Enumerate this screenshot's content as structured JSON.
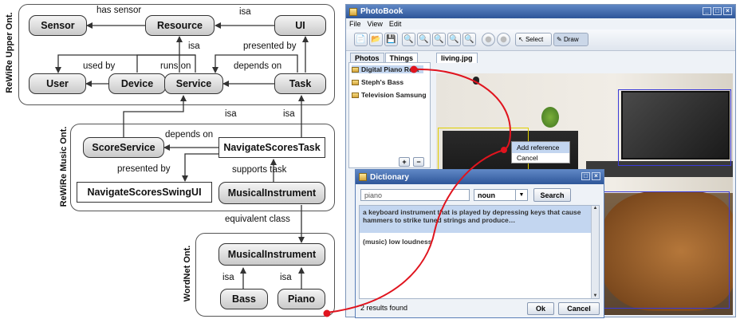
{
  "ontology": {
    "groups": {
      "upper": "ReWiRe Upper Ont.",
      "music": "ReWiRe Music Ont.",
      "wordnet": "WordNet Ont."
    },
    "nodes": {
      "sensor": "Sensor",
      "resource": "Resource",
      "ui": "UI",
      "user": "User",
      "device": "Device",
      "service": "Service",
      "task": "Task",
      "score_service": "ScoreService",
      "navigate_scores_task": "NavigateScoresTask",
      "navigate_scores_swing_ui": "NavigateScoresSwingUI",
      "musical_instrument_music": "MusicalInstrument",
      "musical_instrument_wordnet": "MusicalInstrument",
      "bass": "Bass",
      "piano": "Piano"
    },
    "edges": {
      "has_sensor": "has sensor",
      "isa_resource_ui": "isa",
      "isa_service_resource": "isa",
      "presented_by_upper": "presented by",
      "used_by": "used by",
      "runs_on": "runs on",
      "depends_on_upper": "depends on",
      "isa_score_service": "isa",
      "isa_navigate_task": "isa",
      "depends_on_music": "depends on",
      "presented_by_music": "presented by",
      "supports_task": "supports task",
      "equivalent_class": "equivalent class",
      "isa_bass": "isa",
      "isa_piano": "isa"
    }
  },
  "photobook": {
    "title": "PhotoBook",
    "menu": [
      "File",
      "View",
      "Edit"
    ],
    "toolbar": {
      "select": "Select",
      "draw": "Draw"
    },
    "tabs": [
      "Photos",
      "Things"
    ],
    "things": [
      "Digital Piano Rola",
      "Steph's Bass",
      "Television Samsung"
    ],
    "image_tab": "living.jpg",
    "context_menu": [
      "Add reference",
      "Cancel"
    ],
    "list_buttons": [
      "+",
      "−"
    ]
  },
  "dictionary": {
    "title": "Dictionary",
    "search_value": "piano",
    "pos_value": "noun",
    "search_button": "Search",
    "results": [
      "a keyboard instrument that is played by depressing keys that cause hammers to strike tuned strings and produce…",
      "(music) low loudness"
    ],
    "status": "2 results found",
    "ok_button": "Ok",
    "cancel_button": "Cancel"
  },
  "colors": {
    "reference_link": "#e0141e",
    "titlebar": "#3a65aa",
    "selection": "#c3d6f0"
  }
}
